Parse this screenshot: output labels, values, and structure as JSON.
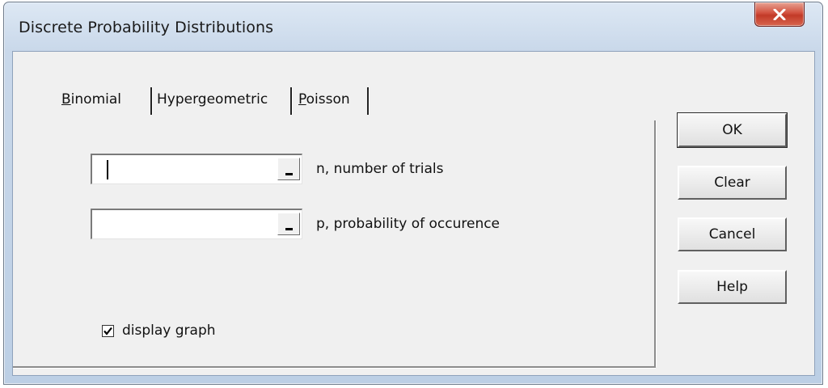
{
  "window": {
    "title": "Discrete Probability Distributions"
  },
  "tabs": [
    {
      "label_prefix": "",
      "label_underlined": "B",
      "label_rest": "inomial",
      "selected": true
    },
    {
      "label_prefix": "Hyper",
      "label_underlined": "g",
      "label_rest": "eometric",
      "selected": false
    },
    {
      "label_prefix": "",
      "label_underlined": "P",
      "label_rest": "oisson",
      "selected": false
    }
  ],
  "fields": [
    {
      "label": "n, number of trials",
      "value": ""
    },
    {
      "label": "p, probability of occurence",
      "value": ""
    }
  ],
  "checkbox": {
    "label": "display graph",
    "checked": true
  },
  "buttons": {
    "ok": "OK",
    "clear": "Clear",
    "cancel": "Cancel",
    "help": "Help"
  },
  "icons": {
    "close": "close-icon",
    "collapse": "collapse-dialog-icon",
    "check": "checkmark-icon"
  }
}
